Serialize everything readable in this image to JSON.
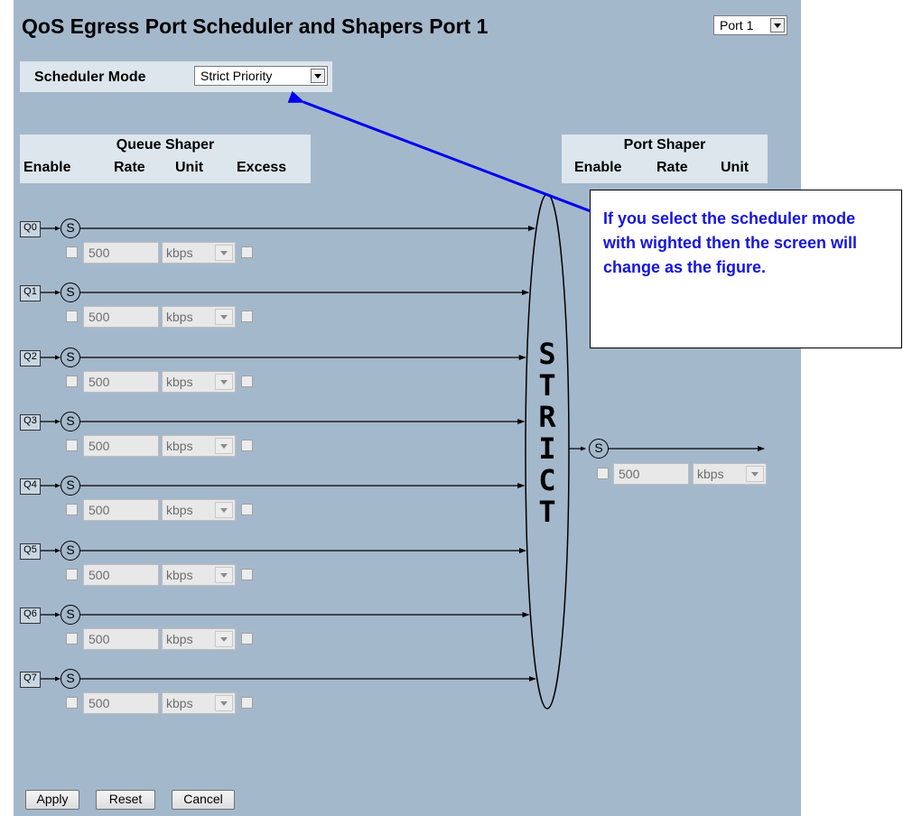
{
  "page": {
    "title": "QoS Egress Port Scheduler and Shapers  Port 1",
    "port_select_value": "Port 1"
  },
  "scheduler": {
    "label": "Scheduler Mode",
    "value": "Strict Priority"
  },
  "queue_shaper": {
    "title": "Queue Shaper",
    "columns": [
      "Enable",
      "Rate",
      "Unit",
      "Excess"
    ]
  },
  "port_shaper": {
    "title": "Port Shaper",
    "columns": [
      "Enable",
      "Rate",
      "Unit"
    ],
    "rate": "500",
    "unit": "kbps",
    "s_label": "S"
  },
  "queues": [
    {
      "label": "Q0",
      "rate": "500",
      "unit": "kbps"
    },
    {
      "label": "Q1",
      "rate": "500",
      "unit": "kbps"
    },
    {
      "label": "Q2",
      "rate": "500",
      "unit": "kbps"
    },
    {
      "label": "Q3",
      "rate": "500",
      "unit": "kbps"
    },
    {
      "label": "Q4",
      "rate": "500",
      "unit": "kbps"
    },
    {
      "label": "Q5",
      "rate": "500",
      "unit": "kbps"
    },
    {
      "label": "Q6",
      "rate": "500",
      "unit": "kbps"
    },
    {
      "label": "Q7",
      "rate": "500",
      "unit": "kbps"
    }
  ],
  "s_label": "S",
  "strict_letters": [
    "S",
    "T",
    "R",
    "I",
    "C",
    "T"
  ],
  "callout": {
    "text": "If you select the scheduler mode with wighted then the screen will change as the figure."
  },
  "buttons": {
    "apply": "Apply",
    "reset": "Reset",
    "cancel": "Cancel"
  },
  "colors": {
    "panel_bg": "#a4b8cc",
    "header_bg": "#dde6ed",
    "callout_text": "#1515e0",
    "arrow": "#0000ee"
  }
}
